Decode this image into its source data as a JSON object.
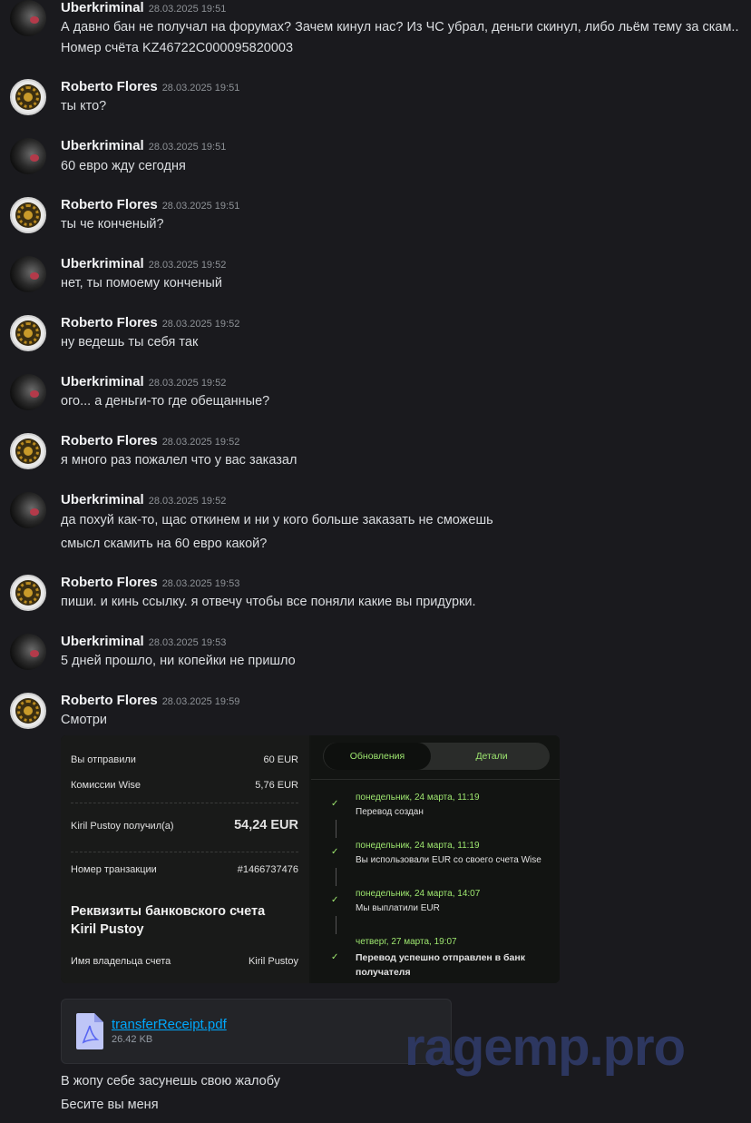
{
  "messages": [
    {
      "author": "Uberkriminal",
      "time": "28.03.2025 19:51",
      "lines": [
        "А давно бан не получал на форумах? Зачем кинул нас? Из ЧС убрал, деньги скинул, либо льём тему за скам..",
        "Номер счёта KZ46722C000095820003"
      ]
    },
    {
      "author": "Roberto Flores",
      "time": "28.03.2025 19:51",
      "lines": [
        "ты кто?"
      ]
    },
    {
      "author": "Uberkriminal",
      "time": "28.03.2025 19:51",
      "lines": [
        "60 евро жду сегодня"
      ]
    },
    {
      "author": "Roberto Flores",
      "time": "28.03.2025 19:51",
      "lines": [
        "ты че конченый?"
      ]
    },
    {
      "author": "Uberkriminal",
      "time": "28.03.2025 19:52",
      "lines": [
        "нет, ты помоему конченый"
      ]
    },
    {
      "author": "Roberto Flores",
      "time": "28.03.2025 19:52",
      "lines": [
        "ну ведешь ты себя так"
      ]
    },
    {
      "author": "Uberkriminal",
      "time": "28.03.2025 19:52",
      "lines": [
        "ого... а деньги-то где обещанные?"
      ]
    },
    {
      "author": "Roberto Flores",
      "time": "28.03.2025 19:52",
      "lines": [
        "я много раз пожалел что у вас заказал"
      ]
    },
    {
      "author": "Uberkriminal",
      "time": "28.03.2025 19:52",
      "lines": [
        "да похуй как-то, щас откинем и ни у кого больше заказать не сможешь",
        "смысл скамить на 60 евро какой?"
      ]
    },
    {
      "author": "Roberto Flores",
      "time": "28.03.2025 19:53",
      "lines": [
        "пиши. и кинь ссылку. я отвечу чтобы все поняли какие вы придурки."
      ]
    },
    {
      "author": "Uberkriminal",
      "time": "28.03.2025 19:53",
      "lines": [
        "5 дней прошло, ни копейки не пришло"
      ]
    },
    {
      "author": "Roberto Flores",
      "time": "28.03.2025 19:59",
      "lines": [
        "Смотри"
      ]
    }
  ],
  "receipt": {
    "sent_label": "Вы отправили",
    "sent_value": "60 EUR",
    "fee_label": "Комиссии Wise",
    "fee_value": "5,76 EUR",
    "recv_label": "Kiril Pustoy получил(а)",
    "recv_value": "54,24 EUR",
    "tx_label": "Номер транзакции",
    "tx_value": "#1466737476",
    "bank_title_1": "Реквизиты банковского счета",
    "bank_title_2": "Kiril Pustoy",
    "holder_label": "Имя владельца счета",
    "holder_value": "Kiril Pustoy",
    "tab_updates": "Обновления",
    "tab_details": "Детали",
    "timeline": [
      {
        "date": "понедельник, 24 марта, 11:19",
        "text": "Перевод создан"
      },
      {
        "date": "понедельник, 24 марта, 11:19",
        "text": "Вы использовали EUR со своего счета Wise"
      },
      {
        "date": "понедельник, 24 марта, 14:07",
        "text": "Мы выплатили EUR"
      },
      {
        "date": "четверг, 27 марта, 19:07",
        "text": "Перевод успешно отправлен в банк",
        "text2": "получателя"
      }
    ]
  },
  "attachment": {
    "name": "transferReceipt.pdf",
    "size": "26.42 KB"
  },
  "followups": [
    "В жопу себе засунешь свою жалобу",
    "Бесите вы меня"
  ],
  "watermark": "ragemp.pro"
}
